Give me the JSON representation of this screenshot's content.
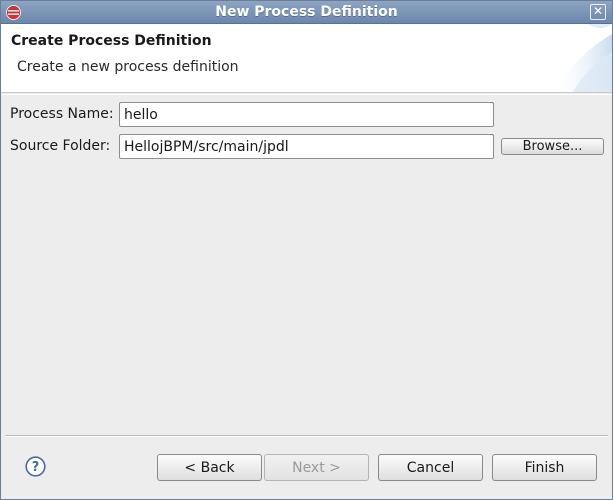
{
  "window": {
    "title": "New Process Definition",
    "close_glyph": "✕",
    "app_icon": "eclipse-icon"
  },
  "banner": {
    "title": "Create Process Definition",
    "description": "Create a new process definition"
  },
  "form": {
    "process_name": {
      "label": "Process Name:",
      "value": "hello"
    },
    "source_folder": {
      "label": "Source Folder:",
      "value": "HellojBPM/src/main/jpdl"
    },
    "browse_label": "Browse..."
  },
  "footer": {
    "help_icon": "help-icon",
    "back_label": "< Back",
    "next_label": "Next >",
    "next_enabled": false,
    "cancel_label": "Cancel",
    "finish_label": "Finish"
  },
  "colors": {
    "titlebar": "#7890b4",
    "accent_icon": "#c8343c",
    "help_icon": "#4a6aa0"
  }
}
